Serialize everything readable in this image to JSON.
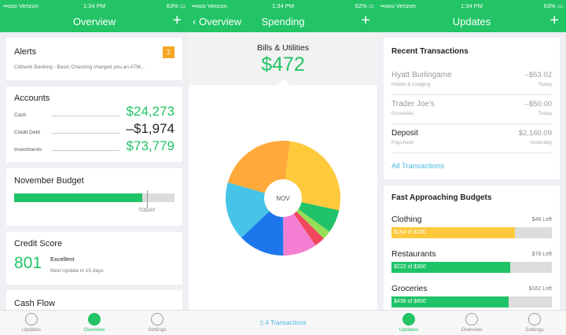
{
  "colors": {
    "accent": "#22c465",
    "budget_bar": "#1ec466",
    "clothing_bar": "#fdc93b"
  },
  "overview": {
    "status": {
      "carrier": "••ooo Verizon",
      "time": "1:34 PM",
      "right": "63%"
    },
    "nav_title": "Overview",
    "alerts": {
      "title": "Alerts",
      "badge": "2",
      "message": "Citibank Banking - Basic Checking charged you an ATM..."
    },
    "accounts": {
      "title": "Accounts",
      "items": [
        {
          "label": "Cash",
          "value": "$24,273"
        },
        {
          "label": "Credit Debt",
          "value": "–$1,974"
        },
        {
          "label": "Investments",
          "value": "$73,779"
        }
      ]
    },
    "budget": {
      "title": "November Budget",
      "progress": 0.8,
      "today_label": "TODAY"
    },
    "credit": {
      "title": "Credit Score",
      "score": "801",
      "rating": "Excellent",
      "next": "Next Update in 15 days"
    },
    "cashflow": {
      "title": "Cash Flow"
    },
    "tabs": [
      "Updates",
      "Overview",
      "Settings"
    ]
  },
  "spending": {
    "status": {
      "carrier": "••ooo Verizon",
      "time": "1:34 PM",
      "right": "62%"
    },
    "back_label": "Overview",
    "nav_title": "Spending",
    "category": "Bills & Utilities",
    "amount": "$472",
    "center_label": "NOV",
    "transactions_link": "4 Transactions",
    "slices": [
      {
        "value": 0.265,
        "color": "#ffc93c"
      },
      {
        "value": 0.065,
        "color": "#20c26a"
      },
      {
        "value": 0.025,
        "color": "#95e054"
      },
      {
        "value": 0.03,
        "color": "#f1475d"
      },
      {
        "value": 0.095,
        "color": "#f47fd2"
      },
      {
        "value": 0.13,
        "color": "#1d77ea"
      },
      {
        "value": 0.165,
        "color": "#46c4e8"
      },
      {
        "value": 0.225,
        "color": "#ffaa3a"
      }
    ]
  },
  "updates": {
    "status": {
      "carrier": "••ooo Verizon",
      "time": "1:34 PM",
      "right": "63%"
    },
    "nav_title": "Updates",
    "recent_title": "Recent Transactions",
    "transactions": [
      {
        "name": "Hyatt Burlingame",
        "category": "Hotels & Lodging",
        "amount": "–$53.02",
        "date": "Today"
      },
      {
        "name": "Trader Joe's",
        "category": "Groceries",
        "amount": "–$50.00",
        "date": "Today"
      },
      {
        "name": "Deposit",
        "category": "Paycheck",
        "amount": "$2,160.09",
        "date": "Yesterday"
      }
    ],
    "all_link": "All Transactions",
    "budgets_title": "Fast Approaching Budgets",
    "budgets": [
      {
        "name": "Clothing",
        "left": "$46 Left",
        "text": "$154 of $200",
        "fraction": 0.77,
        "color": "#fdc93b"
      },
      {
        "name": "Restaurants",
        "left": "$78 Left",
        "text": "$222 of $300",
        "fraction": 0.74,
        "color": "#1ec466"
      },
      {
        "name": "Groceries",
        "left": "$162 Left",
        "text": "$438 of $600",
        "fraction": 0.73,
        "color": "#1ec466"
      }
    ],
    "tabs": [
      "Updates",
      "Overview",
      "Settings"
    ]
  }
}
